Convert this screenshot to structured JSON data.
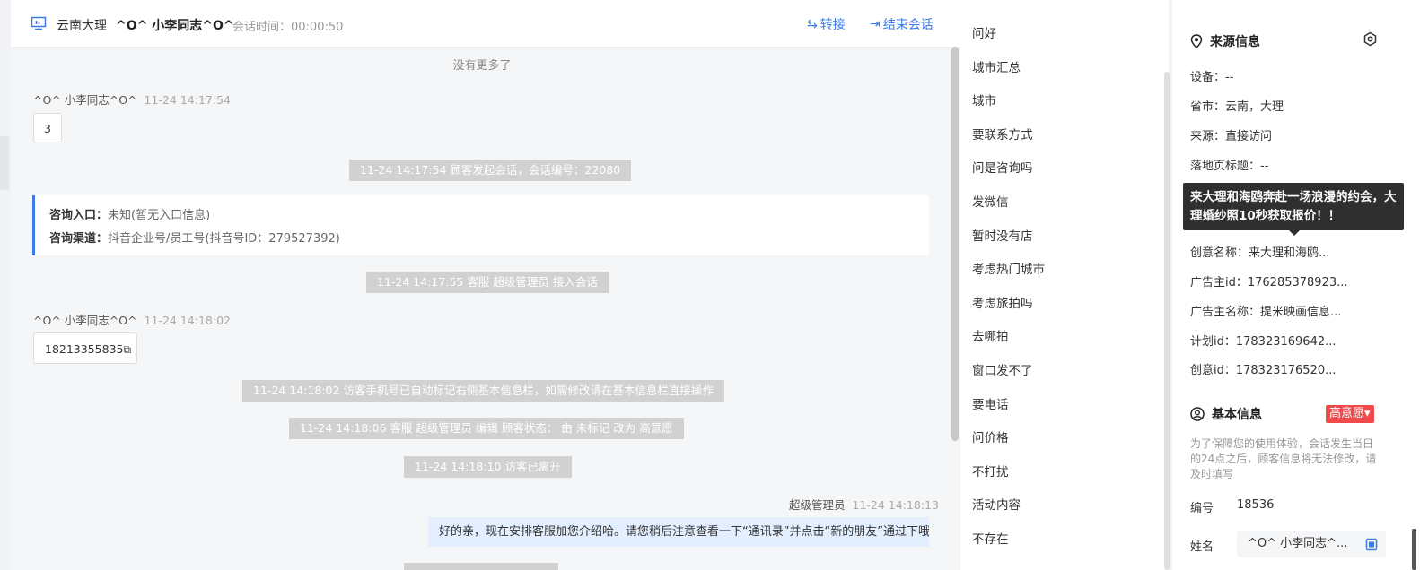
{
  "header": {
    "region": "云南大理",
    "visitor_name": "^O^ 小李同志^O^",
    "session_time": "会话时间：00:00:50",
    "transfer_label": "转接",
    "end_label": "结束会话"
  },
  "chat": {
    "no_more": "没有更多了",
    "messages": [
      {
        "sender": "^O^ 小李同志^O^",
        "time": "11-24 14:17:54",
        "text": "3"
      },
      {
        "sender": "^O^ 小李同志^O^",
        "time": "11-24 14:18:02",
        "text": "18213355835"
      }
    ],
    "system": [
      "11-24 14:17:54 顾客发起会话，会话编号：22080",
      "11-24 14:17:55 客服 超级管理员 接入会话",
      "11-24 14:18:02 访客手机号已自动标记右侧基本信息栏，如需修改请在基本信息栏直接操作",
      "11-24 14:18:06 客服 超级管理员 编辑 顾客状态： 由 未标记 改为 高意愿",
      "11-24 14:18:10 访客已离开"
    ],
    "entry": {
      "entry_label": "咨询入口：",
      "entry_value": "未知(暂无入口信息)",
      "channel_label": "咨询渠道：",
      "channel_value": "抖音企业号/员工号(抖音号ID：279527392)"
    },
    "agent": {
      "name": "超级管理员",
      "time": "11-24 14:18:13",
      "text": "好的亲，现在安排客服加您介绍哈。请您稍后注意查看一下“通讯录”并点击“新的朋友”通过下哦"
    }
  },
  "quick_replies": [
    "问好",
    "城市汇总",
    "城市",
    "要联系方式",
    "问是咨询吗",
    "发微信",
    "暂时没有店",
    "考虑热门城市",
    "考虑旅拍吗",
    "去哪拍",
    "窗口发不了",
    "要电话",
    "问价格",
    "不打扰",
    "活动内容",
    "不存在"
  ],
  "info": {
    "source_title": "来源信息",
    "source_fields": [
      "设备：--",
      "省市：云南，大理",
      "来源：直接访问",
      "落地页标题：--",
      "创意名称：来大理和海鸥...",
      "广告主id：176285378923...",
      "广告主名称：提米映画信息...",
      "计划id：178323169642...",
      "创意id：178323176520..."
    ],
    "tooltip": "来大理和海鸥奔赴一场浪漫的约会，大理婚纱照10秒获取报价！！",
    "basic_title": "基本信息",
    "intent_badge": "高意愿▾",
    "note": "为了保障您的使用体验，会话发生当日的24点之后，顾客信息将无法修改，请及时填写",
    "id_label": "编号",
    "id_value": "18536",
    "name_label": "姓名",
    "name_value": "^O^ 小李同志^..."
  },
  "colors": {
    "accent": "#3a7be8",
    "badge": "#f04a4a",
    "system_bg": "#d1d1d1",
    "agent_bubble": "#e3eefe"
  }
}
